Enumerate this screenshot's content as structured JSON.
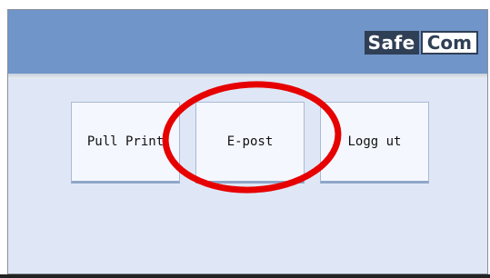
{
  "header": {
    "logo_part1": "Safe",
    "logo_part2": "Com"
  },
  "buttons": [
    {
      "label": "Pull Print"
    },
    {
      "label": "E-post"
    },
    {
      "label": "Logg ut"
    }
  ],
  "annotation": {
    "color": "#e60000",
    "target": "E-post"
  },
  "colors": {
    "header": "#7095c8",
    "panel": "#dfe7f6",
    "logo_dark": "#2f3f56"
  }
}
